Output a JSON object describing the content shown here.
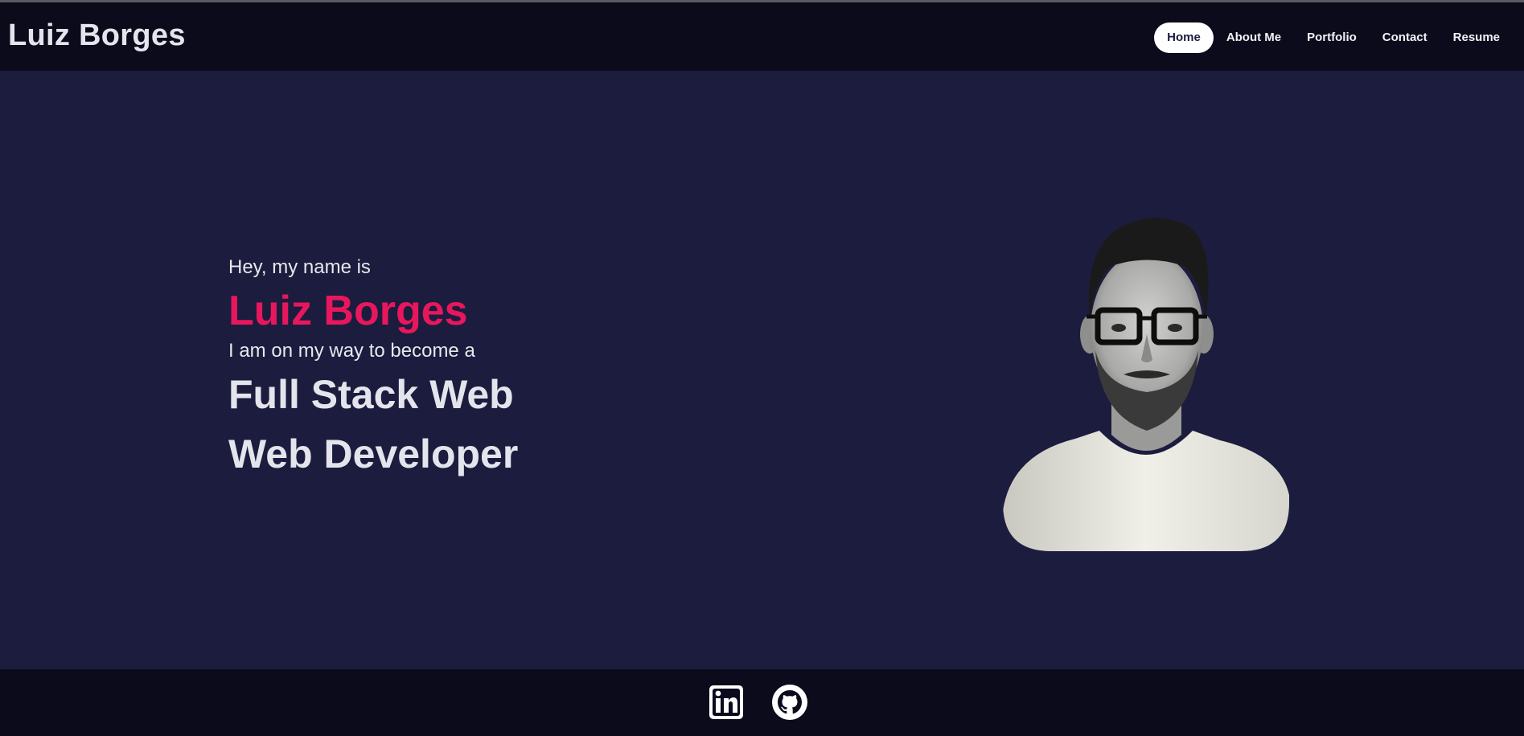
{
  "header": {
    "brand": "Luiz Borges",
    "nav": [
      {
        "label": "Home",
        "active": true
      },
      {
        "label": "About Me",
        "active": false
      },
      {
        "label": "Portfolio",
        "active": false
      },
      {
        "label": "Contact",
        "active": false
      },
      {
        "label": "Resume",
        "active": false
      }
    ]
  },
  "hero": {
    "greeting": "Hey, my name is",
    "name": "Luiz Borges",
    "subtitle": "I am on my way to become a",
    "role_line1": "Full Stack Web",
    "role_line2": "Web Developer",
    "portrait_icon": "profile-photo"
  },
  "footer": {
    "links": [
      {
        "icon": "linkedin-icon"
      },
      {
        "icon": "github-icon"
      }
    ]
  },
  "colors": {
    "header_bg": "#0b0b1c",
    "main_bg": "#1c1c3e",
    "accent": "#e8175d",
    "text": "#e8e8ee"
  }
}
